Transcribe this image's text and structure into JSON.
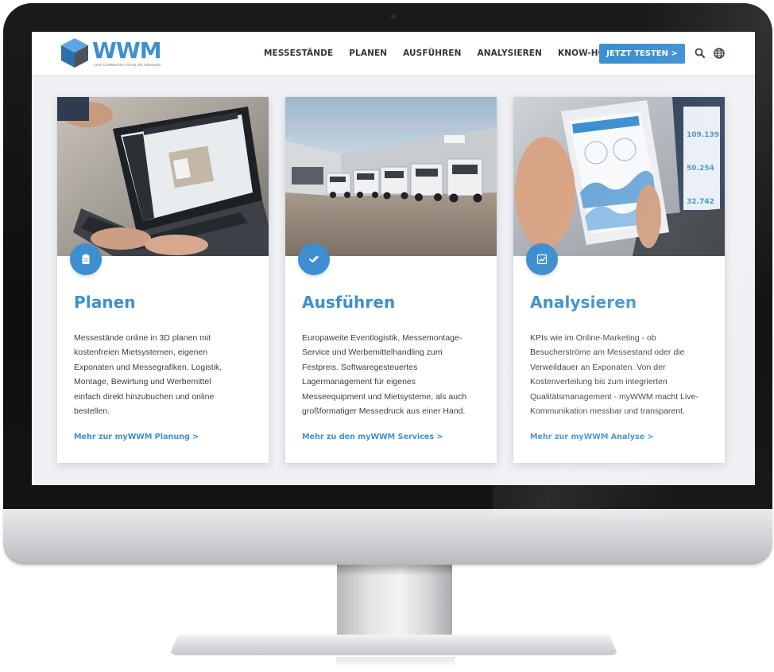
{
  "brand": {
    "logo_text": "WWM",
    "tagline": "LIVE COMMUNICATION ON DEMAND",
    "accent_color": "#3d8fd1"
  },
  "nav": {
    "items": [
      {
        "label": "MESSESTÄNDE"
      },
      {
        "label": "PLANEN"
      },
      {
        "label": "AUSFÜHREN"
      },
      {
        "label": "ANALYSIEREN"
      },
      {
        "label": "KNOW-HOW"
      }
    ],
    "cta_label": "JETZT TESTEN >",
    "search_icon": "search-icon",
    "language_icon": "globe-icon"
  },
  "cards": [
    {
      "icon": "clipboard-icon",
      "title": "Planen",
      "lines": [
        "Messestände online in 3D planen mit",
        "kostenfreien Mietsystemen, eigenen",
        "Exponaten und Messegrafiken. Logistik,",
        "Montage, Bewirtung und Werbemittel",
        "einfach direkt hinzubuchen und online",
        "bestellen."
      ],
      "link": "Mehr zur myWWM Planung >"
    },
    {
      "icon": "double-check-icon",
      "title": "Ausführen",
      "lines": [
        "Europaweite Eventlogistik, Messemontage-",
        "Service und Werbemittelhandling zum",
        "Festpreis. Softwaregesteuertes",
        "Lagermanagement für eigenes",
        "Messeequipment und Mietsysteme, als auch",
        "großformatiger Messedruck aus einer Hand."
      ],
      "link": "Mehr zu den myWWM Services >"
    },
    {
      "icon": "line-chart-icon",
      "title": "Analysieren",
      "lines": [
        "KPIs wie im Online-Marketing - ob",
        "Besucherströme am Messestand oder die",
        "Verweildauer an Exponaten. Von der",
        "Kostenverteilung bis zum integrierten",
        "Qualitätsmanagement - myWWM macht Live-",
        "Kommunikation messbar und transparent."
      ],
      "link": "Mehr zur myWWM Analyse >"
    }
  ],
  "phone_screen": {
    "values": [
      "109.139",
      "50.254",
      "32.742"
    ]
  }
}
